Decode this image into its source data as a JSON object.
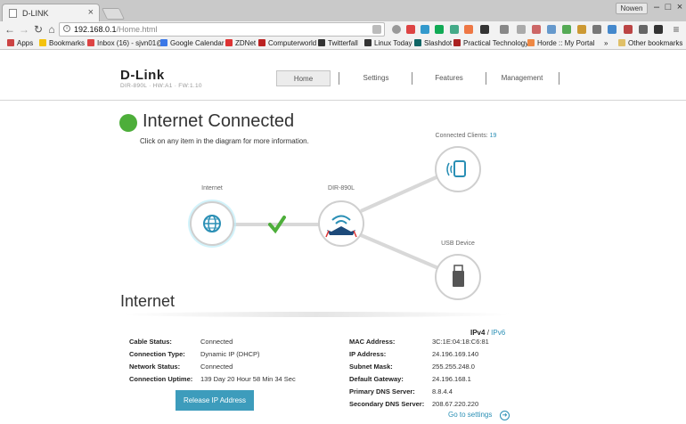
{
  "browser": {
    "tab_title": "D-LINK",
    "user": "Nowen",
    "url_host": "192.168.0.1",
    "url_path": "/Home.html",
    "bookmarks": [
      {
        "label": "Apps",
        "color": "#c44"
      },
      {
        "label": "Bookmarks",
        "color": "#f4c20d"
      },
      {
        "label": "Inbox (16) - sjvn01@",
        "color": "#d44"
      },
      {
        "label": "Google Calendar",
        "color": "#3b78e7"
      },
      {
        "label": "ZDNet",
        "color": "#d33"
      },
      {
        "label": "Computerworld",
        "color": "#b22"
      },
      {
        "label": "Twitterfall",
        "color": "#333"
      },
      {
        "label": "Linux Today",
        "color": "#333"
      },
      {
        "label": "Slashdot",
        "color": "#166"
      },
      {
        "label": "Practical Technology",
        "color": "#a22"
      },
      {
        "label": "Horde :: My Portal",
        "color": "#e84"
      }
    ],
    "overflow": "»",
    "other_bookmarks": "Other bookmarks"
  },
  "header": {
    "logo": "D-Link",
    "model": "DIR-890L · HW:A1 · FW:1.10",
    "tabs": [
      "Home",
      "Settings",
      "Features",
      "Management"
    ]
  },
  "status": {
    "title": "Internet Connected",
    "subtitle": "Click on any item in the diagram for more information.",
    "color": "#4dae3a"
  },
  "diagram": {
    "internet_label": "Internet",
    "router_label": "DIR-890L",
    "clients_label": "Connected Clients:",
    "clients_count": "19",
    "usb_label": "USB Device"
  },
  "internet": {
    "title": "Internet",
    "ipv4": "IPv4",
    "sep": "/",
    "ipv6": "IPv6",
    "left": [
      {
        "label": "Cable Status:",
        "value": "Connected"
      },
      {
        "label": "Connection Type:",
        "value": "Dynamic IP (DHCP)"
      },
      {
        "label": "Network Status:",
        "value": "Connected"
      },
      {
        "label": "Connection Uptime:",
        "value": "139 Day 20 Hour 58 Min 34 Sec"
      }
    ],
    "right": [
      {
        "label": "MAC Address:",
        "value": "3C:1E:04:18:C6:81"
      },
      {
        "label": "IP Address:",
        "value": "24.196.169.140"
      },
      {
        "label": "Subnet Mask:",
        "value": "255.255.248.0"
      },
      {
        "label": "Default Gateway:",
        "value": "24.196.168.1"
      },
      {
        "label": "Primary DNS Server:",
        "value": "8.8.4.4"
      },
      {
        "label": "Secondary DNS Server:",
        "value": "208.67.220.220"
      }
    ],
    "release_button": "Release IP Address",
    "goto_settings": "Go to settings"
  }
}
